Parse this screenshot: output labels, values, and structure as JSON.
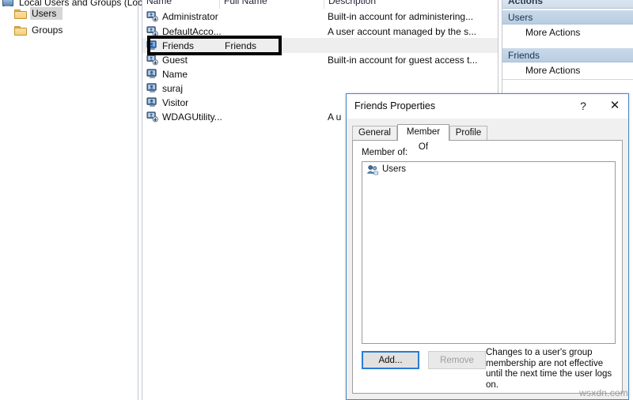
{
  "tree": {
    "root_label": "Local Users and Groups (Local)",
    "items": [
      {
        "label": "Users",
        "icon": "folder-icon"
      },
      {
        "label": "Groups",
        "icon": "folder-icon"
      }
    ]
  },
  "list": {
    "columns": [
      "Name",
      "Full Name",
      "Description"
    ],
    "rows": [
      {
        "name": "Administrator",
        "full_name": "",
        "description": "Built-in account for administering..."
      },
      {
        "name": "DefaultAcco...",
        "full_name": "",
        "description": "A user account managed by the s..."
      },
      {
        "name": "Friends",
        "full_name": "Friends",
        "description": ""
      },
      {
        "name": "Guest",
        "full_name": "",
        "description": "Built-in account for guest access t..."
      },
      {
        "name": "Name",
        "full_name": "",
        "description": ""
      },
      {
        "name": "suraj",
        "full_name": "",
        "description": ""
      },
      {
        "name": "Visitor",
        "full_name": "",
        "description": ""
      },
      {
        "name": "WDAGUtility...",
        "full_name": "",
        "description": "A u"
      }
    ]
  },
  "actions": {
    "title": "Actions",
    "groups": [
      {
        "header": "Users",
        "items": [
          "More Actions"
        ]
      },
      {
        "header": "Friends",
        "items": [
          "More Actions"
        ]
      }
    ]
  },
  "dialog": {
    "title": "Friends Properties",
    "help_glyph": "?",
    "close_glyph": "✕",
    "tabs": [
      {
        "label": "General",
        "active": false
      },
      {
        "label": "Member Of",
        "active": true
      },
      {
        "label": "Profile",
        "active": false
      }
    ],
    "member_of_label": "Member of:",
    "member_of_items": [
      {
        "label": "Users",
        "icon": "group-icon"
      }
    ],
    "add_button": "Add...",
    "remove_button": "Remove",
    "membership_note": "Changes to a user's group membership are not effective until the next time the user logs on."
  },
  "watermark": "wsxdn.com",
  "colors": {
    "dialog_border": "#4a86c5",
    "focus_border": "#2a7bd5",
    "actions_group_header": "#c9d9ea",
    "callout": "#000000",
    "selection_shade": "#eeeeee"
  }
}
